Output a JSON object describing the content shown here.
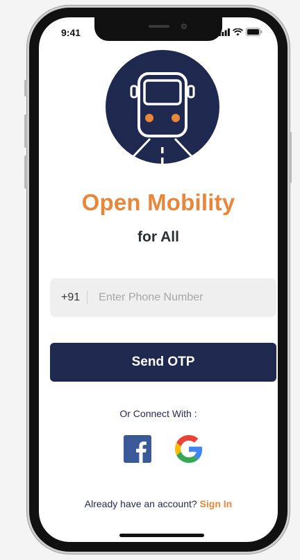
{
  "status_bar": {
    "time": "9:41",
    "icons": [
      "signal-icon",
      "wifi-icon",
      "battery-icon"
    ]
  },
  "brand": {
    "logo_icon": "bus-icon",
    "title": "Open Mobility",
    "subtitle": "for All",
    "accent_color": "#e8863a",
    "primary_color": "#1f2950"
  },
  "login": {
    "country_code": "+91",
    "phone_placeholder": "Enter Phone Number",
    "phone_value": "",
    "send_otp_label": "Send OTP"
  },
  "social": {
    "heading": "Or Connect With :",
    "providers": [
      "facebook-icon",
      "google-icon"
    ]
  },
  "footer": {
    "prompt": "Already have an account?",
    "sign_in_label": "Sign In"
  }
}
